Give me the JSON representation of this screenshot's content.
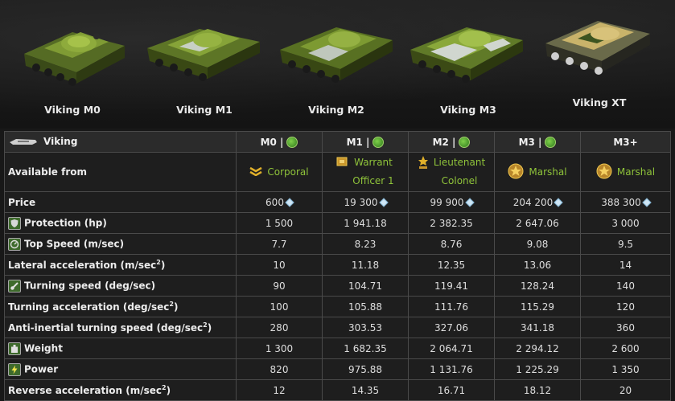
{
  "tanks": [
    {
      "name": "Viking M0"
    },
    {
      "name": "Viking M1"
    },
    {
      "name": "Viking M2"
    },
    {
      "name": "Viking M3"
    },
    {
      "name": "Viking XT"
    }
  ],
  "table": {
    "corner_label": "Viking",
    "columns": [
      {
        "label": "M0 |",
        "badge": true
      },
      {
        "label": "M1 |",
        "badge": true
      },
      {
        "label": "M2 |",
        "badge": true
      },
      {
        "label": "M3 |",
        "badge": true
      },
      {
        "label": "M3+",
        "badge": false
      }
    ],
    "available_from": {
      "label": "Available from",
      "ranks": [
        {
          "name": "Corporal",
          "icon": "corporal-chevron-icon"
        },
        {
          "name_line1": "Warrant",
          "name_line2": "Officer 1",
          "icon": "warrant-officer-icon"
        },
        {
          "name_line1": "Lieutenant",
          "name_line2": "Colonel",
          "icon": "lieutenant-colonel-icon"
        },
        {
          "name": "Marshal",
          "icon": "marshal-star-icon"
        },
        {
          "name": "Marshal",
          "icon": "marshal-star-icon"
        }
      ]
    },
    "rows": [
      {
        "label": "Price",
        "icon": "",
        "values": [
          "600",
          "19 300",
          "99 900",
          "204 200",
          "388 300"
        ],
        "currency_icon": "crystal-icon"
      },
      {
        "label": "Protection (hp)",
        "icon": "shield-icon",
        "values": [
          "1 500",
          "1 941.18",
          "2 382.35",
          "2 647.06",
          "3 000"
        ]
      },
      {
        "label": "Top Speed (m/sec)",
        "icon": "speedometer-icon",
        "values": [
          "7.7",
          "8.23",
          "8.76",
          "9.08",
          "9.5"
        ]
      },
      {
        "label": "Lateral acceleration (m/sec",
        "sup": "2",
        "suffix": ")",
        "icon": "",
        "values": [
          "10",
          "11.18",
          "12.35",
          "13.06",
          "14"
        ]
      },
      {
        "label": "Turning speed (deg/sec)",
        "icon": "turret-icon",
        "values": [
          "90",
          "104.71",
          "119.41",
          "128.24",
          "140"
        ]
      },
      {
        "label": "Turning acceleration (deg/sec",
        "sup": "2",
        "suffix": ")",
        "icon": "",
        "values": [
          "100",
          "105.88",
          "111.76",
          "115.29",
          "120"
        ]
      },
      {
        "label": "Anti-inertial turning speed (deg/sec",
        "sup": "2",
        "suffix": ")",
        "icon": "",
        "values": [
          "280",
          "303.53",
          "327.06",
          "341.18",
          "360"
        ]
      },
      {
        "label": "Weight",
        "icon": "weight-icon",
        "values": [
          "1 300",
          "1 682.35",
          "2 064.71",
          "2 294.12",
          "2 600"
        ]
      },
      {
        "label": "Power",
        "icon": "lightning-icon",
        "values": [
          "820",
          "975.88",
          "1 131.76",
          "1 225.29",
          "1 350"
        ]
      },
      {
        "label": "Reverse acceleration (m/sec",
        "sup": "2",
        "suffix": ")",
        "icon": "",
        "values": [
          "12",
          "14.35",
          "16.71",
          "18.12",
          "20"
        ]
      }
    ]
  }
}
